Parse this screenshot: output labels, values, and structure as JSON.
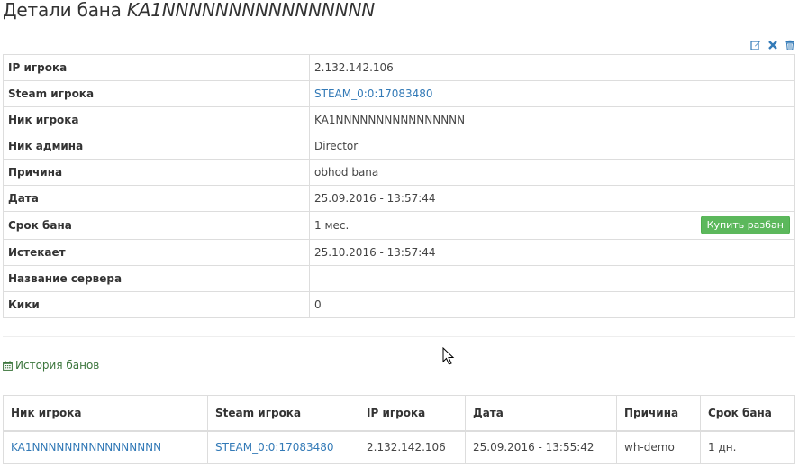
{
  "header": {
    "title_prefix": "Детали бана",
    "title_nick": "KA1NNNNNNNNNNNNNNNN"
  },
  "actions": {
    "icons": [
      "edit-icon",
      "close-icon",
      "trash-icon"
    ]
  },
  "details": {
    "rows": [
      {
        "label": "IP игрока",
        "value": "2.132.142.106"
      },
      {
        "label": "Steam игрока",
        "value": "STEAM_0:0:17083480"
      },
      {
        "label": "Ник игрока",
        "value": "KA1NNNNNNNNNNNNNNNN"
      },
      {
        "label": "Ник админа",
        "value": "Director"
      },
      {
        "label": "Причина",
        "value": "obhod bana"
      },
      {
        "label": "Дата",
        "value": "25.09.2016 - 13:57:44"
      },
      {
        "label": "Срок бана",
        "value": "1 мес."
      },
      {
        "label": "Истекает",
        "value": "25.10.2016 - 13:57:44"
      },
      {
        "label": "Название сервера",
        "value": ""
      },
      {
        "label": "Кики",
        "value": "0"
      }
    ],
    "buy_unban_label": "Купить разбан"
  },
  "history": {
    "title": "История банов",
    "columns": [
      "Ник игрока",
      "Steam игрока",
      "IP игрока",
      "Дата",
      "Причина",
      "Срок бана"
    ],
    "rows": [
      {
        "nick": "KA1NNNNNNNNNNNNNNNN",
        "steam": "STEAM_0:0:17083480",
        "ip": "2.132.142.106",
        "date": "25.09.2016 - 13:55:42",
        "reason": "wh-demo",
        "term": "1 дн."
      }
    ]
  },
  "colors": {
    "link": "#337ab7",
    "success": "#5cb85c",
    "history_title": "#3c763d",
    "border": "#dddddd"
  }
}
